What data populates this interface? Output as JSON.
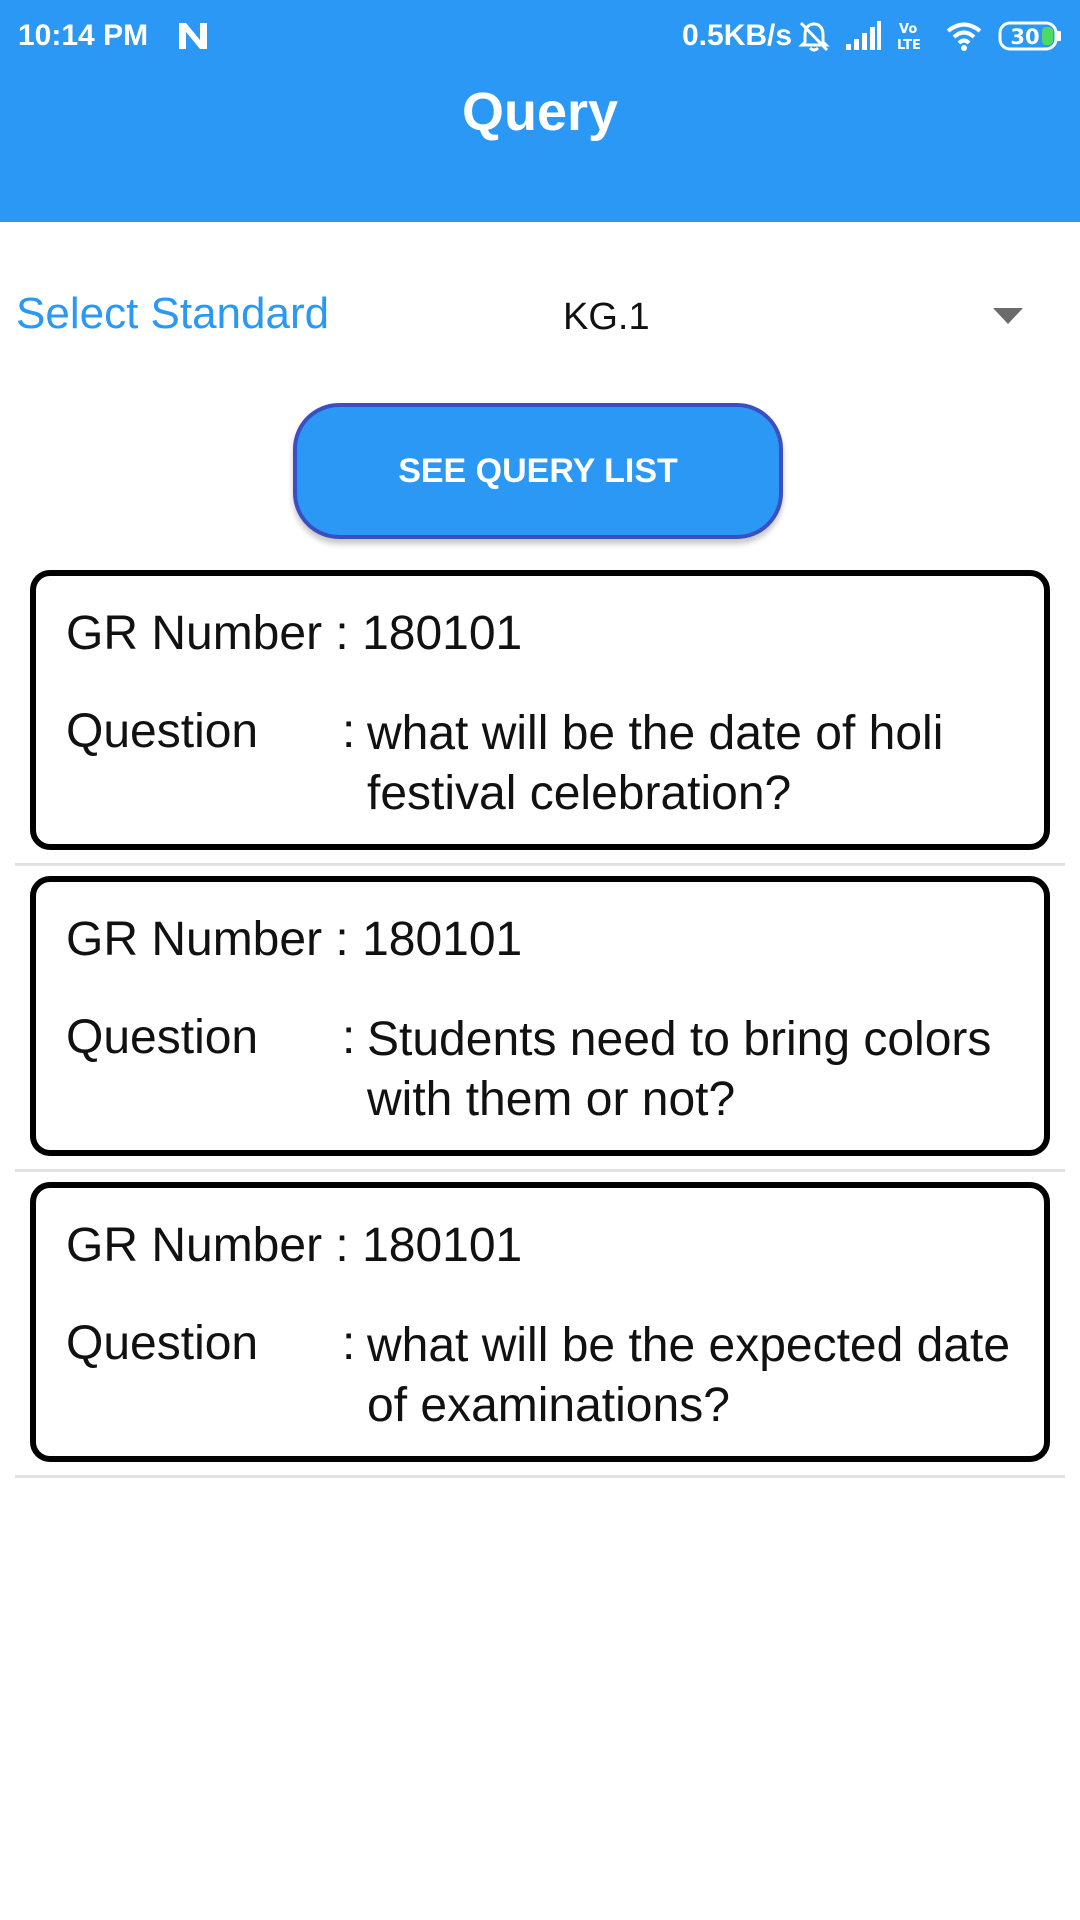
{
  "status_bar": {
    "time": "10:14 PM",
    "net_speed": "0.5KB/s",
    "battery": "30",
    "icons": [
      "n-icon",
      "alarm-off-icon",
      "signal-icon",
      "volte-icon",
      "wifi-icon",
      "battery-icon"
    ]
  },
  "header": {
    "title": "Query"
  },
  "standard": {
    "label": "Select Standard",
    "value": "KG.1",
    "dropdown_icon": "dropdown-arrow-icon"
  },
  "actions": {
    "see_query_list": "SEE QUERY LIST"
  },
  "queries": [
    {
      "gr_label": "GR Number : ",
      "gr_number": "180101",
      "question_label": "Question",
      "colon": ":",
      "question": "what will be the date of holi festival celebration?"
    },
    {
      "gr_label": "GR Number : ",
      "gr_number": "180101",
      "question_label": "Question",
      "colon": ":",
      "question": "Students need to bring colors with them or not?"
    },
    {
      "gr_label": "GR Number : ",
      "gr_number": "180101",
      "question_label": "Question",
      "colon": ":",
      "question": "what will be the expected date of examinations?"
    }
  ],
  "colors": {
    "primary": "#2a98f4",
    "button_border": "#3b4fc1",
    "card_border": "#000000",
    "battery_green": "#4cd964"
  }
}
